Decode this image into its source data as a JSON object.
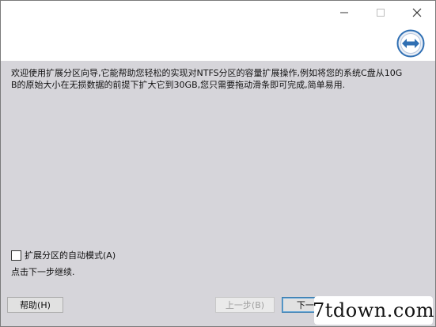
{
  "window": {
    "controls": {
      "minimize_icon": "minimize-icon",
      "maximize_icon": "maximize-icon",
      "close_icon": "close-icon"
    }
  },
  "header": {
    "logo_icon": "double-arrow-logo-icon"
  },
  "main": {
    "intro_text": "欢迎使用扩展分区向导,它能帮助您轻松的实现对NTFS分区的容量扩展操作,例如将您的系统C盘从10GB的原始大小在无损数据的前提下扩大它到30GB,您只需要拖动滑条即可完成,简单易用.",
    "auto_mode_label": "扩展分区的自动模式(A)",
    "auto_mode_checked": false,
    "continue_hint": "点击下一步继续."
  },
  "footer": {
    "help_label": "帮助(H)",
    "prev_label": "上一步(B)",
    "next_label": "下一步(",
    "watermark_text": "7tdown.com"
  },
  "colors": {
    "panel_bg": "#d6d5da",
    "logo_blue": "#2f6fb3",
    "next_focus": "#3c7fb1"
  }
}
